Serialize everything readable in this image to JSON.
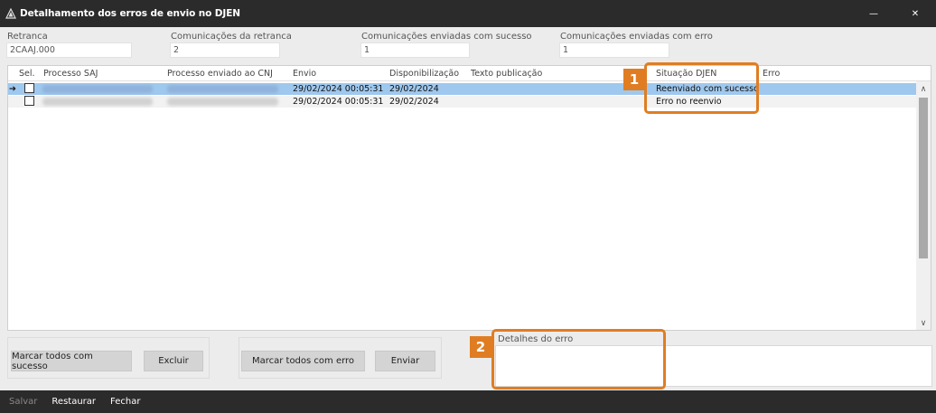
{
  "window": {
    "title": "Detalhamento dos erros de envio no DJEN",
    "minimize_glyph": "—",
    "close_glyph": "✕"
  },
  "fields": {
    "retranca": {
      "label": "Retranca",
      "value": "2CAAJ.000"
    },
    "com_retranca": {
      "label": "Comunicações da retranca",
      "value": "2"
    },
    "com_sucesso": {
      "label": "Comunicações enviadas com sucesso",
      "value": "1"
    },
    "com_erro": {
      "label": "Comunicações enviadas com erro",
      "value": "1"
    }
  },
  "grid": {
    "headers": {
      "sel": "Sel.",
      "processo_saj": "Processo SAJ",
      "processo_cnj": "Processo enviado ao CNJ",
      "envio": "Envio",
      "disponibilizacao": "Disponibilização",
      "texto": "Texto publicação",
      "situacao": "Situação DJEN",
      "erro": "Erro"
    },
    "rows": [
      {
        "envio": "29/02/2024 00:05:31",
        "disponibilizacao": "29/02/2024",
        "situacao": "Reenviado com sucesso",
        "selected": true
      },
      {
        "envio": "29/02/2024 00:05:31",
        "disponibilizacao": "29/02/2024",
        "situacao": "Erro no reenvio",
        "selected": false
      }
    ],
    "current_row_marker": "➔",
    "scroll_up": "∧",
    "scroll_down": "∨"
  },
  "buttons": {
    "marcar_sucesso": "Marcar todos com sucesso",
    "excluir": "Excluir",
    "marcar_erro": "Marcar todos com erro",
    "enviar": "Enviar"
  },
  "details": {
    "label": "Detalhes do erro",
    "value": ""
  },
  "annotations": {
    "badge1": "1",
    "badge2": "2"
  },
  "footer": {
    "salvar": "Salvar",
    "restaurar": "Restaurar",
    "fechar": "Fechar"
  },
  "colors": {
    "accent": "#e07d22",
    "selected_row": "#9fc8ee",
    "titlebar": "#2b2b2b"
  }
}
